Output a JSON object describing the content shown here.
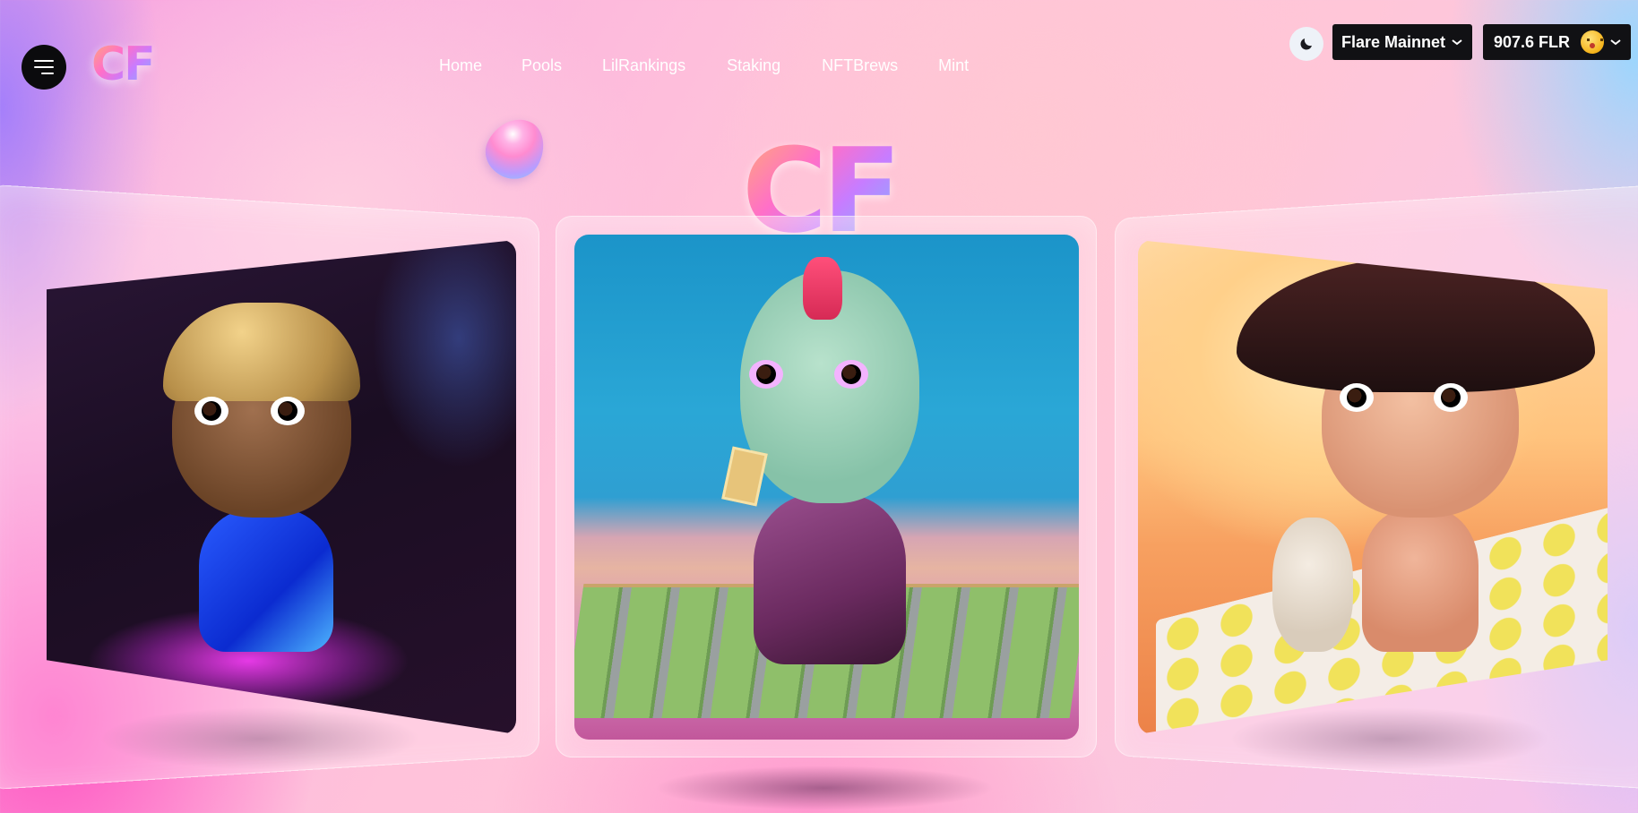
{
  "header": {
    "logo_text": "CF",
    "nav": [
      {
        "label": "Home"
      },
      {
        "label": "Pools"
      },
      {
        "label": "LilRankings"
      },
      {
        "label": "Staking"
      },
      {
        "label": "NFTBrews"
      },
      {
        "label": "Mint"
      }
    ],
    "network": "Flare Mainnet",
    "balance": "907.6 FLR"
  },
  "hero": {
    "logo_text": "CF"
  },
  "icons": {
    "menu": "hamburger-menu-icon",
    "theme": "moon-icon",
    "chevron": "chevron-down-icon",
    "avatar": "emoji-avatar-icon"
  },
  "colors": {
    "button_bg": "#111114",
    "nav_text": "#ffffff",
    "accent_pink": "#ff6fc8",
    "accent_blue": "#6ec3ff"
  }
}
